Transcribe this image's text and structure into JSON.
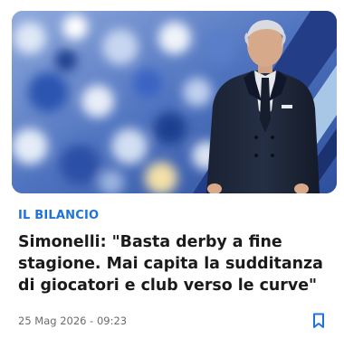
{
  "article": {
    "category": "IL BILANCIO",
    "title": "Simonelli: \"Basta derby a fine stagione. Mai capita la sudditanza di giocatori e club verso le curve\"",
    "date": "25 Mag 2026 - 09:23"
  },
  "colors": {
    "accent": "#1e73d9",
    "title": "#1a1a1a",
    "date": "#6b6b6b"
  },
  "icons": {
    "bookmark": "bookmark-icon"
  }
}
